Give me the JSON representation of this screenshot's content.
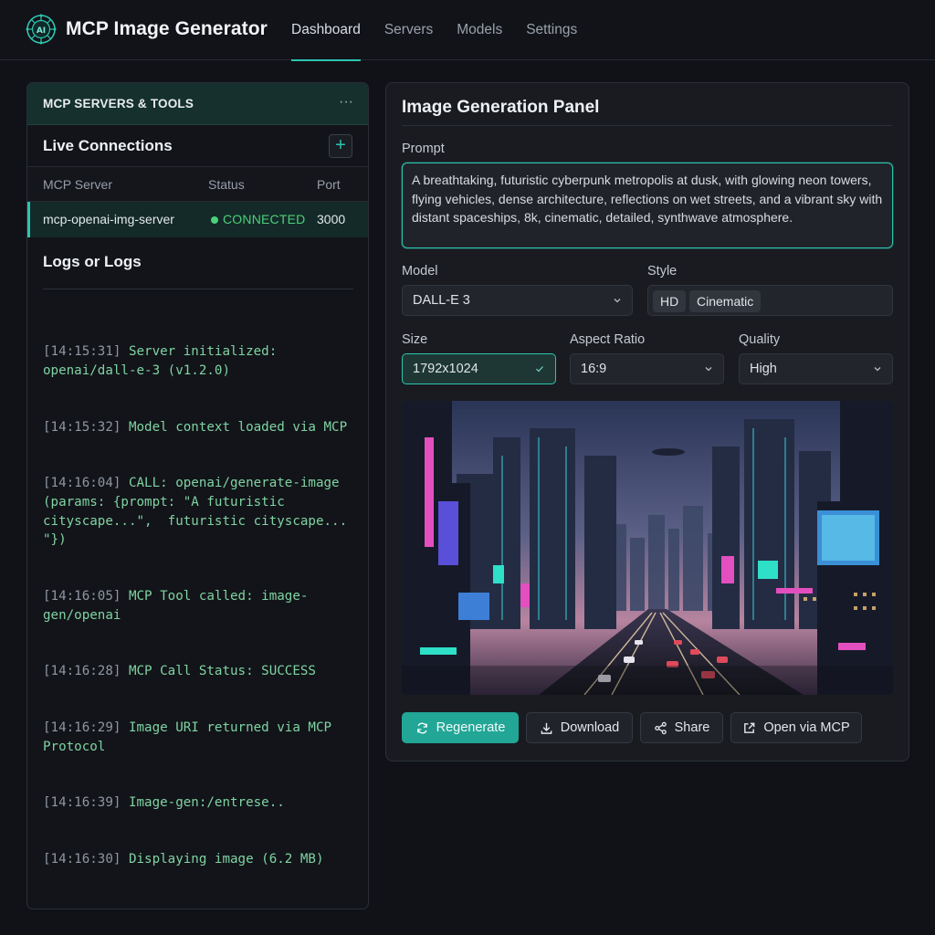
{
  "app": {
    "title": "MCP Image Generator"
  },
  "nav": [
    {
      "label": "Dashboard",
      "active": true
    },
    {
      "label": "Servers",
      "active": false
    },
    {
      "label": "Models",
      "active": false
    },
    {
      "label": "Settings",
      "active": false
    }
  ],
  "left": {
    "header": "MCP SERVERS & TOOLS",
    "more": "···",
    "live_title": "Live Connections",
    "add": "+",
    "columns": [
      "MCP Server",
      "Status",
      "Port"
    ],
    "servers": [
      {
        "name": "mcp-openai-img-server",
        "status": "CONNECTED",
        "port": "3000"
      }
    ],
    "logs_title": "Logs or Logs",
    "logs": [
      {
        "ts": "[14:15:31]",
        "msg": " Server initialized: openai/dall-e-3 (v1.2.0)"
      },
      {
        "ts": "[14:15:32]",
        "msg": " Model context loaded via MCP"
      },
      {
        "ts": "[14:16:04]",
        "msg": " CALL: openai/generate-image (params: {prompt: \"A futuristic cityscape...\",  futuristic cityscape... \"})"
      },
      {
        "ts": "[14:16:05]",
        "msg": " MCP Tool called: image-gen/openai"
      },
      {
        "ts": "[14:16:28]",
        "msg": " MCP Call Status: SUCCESS"
      },
      {
        "ts": "[14:16:29]",
        "msg": " Image URI returned via MCP Protocol"
      },
      {
        "ts": "[14:16:39]",
        "msg": " Image-gen:/entrese.."
      },
      {
        "ts": "[14:16:30]",
        "msg": " Displaying image (6.2 MB)"
      }
    ]
  },
  "panel": {
    "title": "Image Generation Panel",
    "prompt_label": "Prompt",
    "prompt": "A breathtaking, futuristic cyberpunk metropolis at dusk, with glowing neon towers, flying vehicles, dense architecture, reflections on wet streets, and a vibrant sky with distant spaceships, 8k, cinematic, detailed, synthwave atmosphere.",
    "model_label": "Model",
    "model": "DALL-E 3",
    "style_label": "Style",
    "styles": [
      "HD",
      "Cinematic"
    ],
    "size_label": "Size",
    "size": "1792x1024",
    "aspect_label": "Aspect Ratio",
    "aspect": "16:9",
    "quality_label": "Quality",
    "quality": "High",
    "buttons": {
      "regenerate": "Regenerate",
      "download": "Download",
      "share": "Share",
      "open_mcp": "Open via MCP"
    }
  },
  "colors": {
    "accent": "#2ec4b0",
    "connected": "#4cd07a",
    "primary_button": "#22a696"
  }
}
